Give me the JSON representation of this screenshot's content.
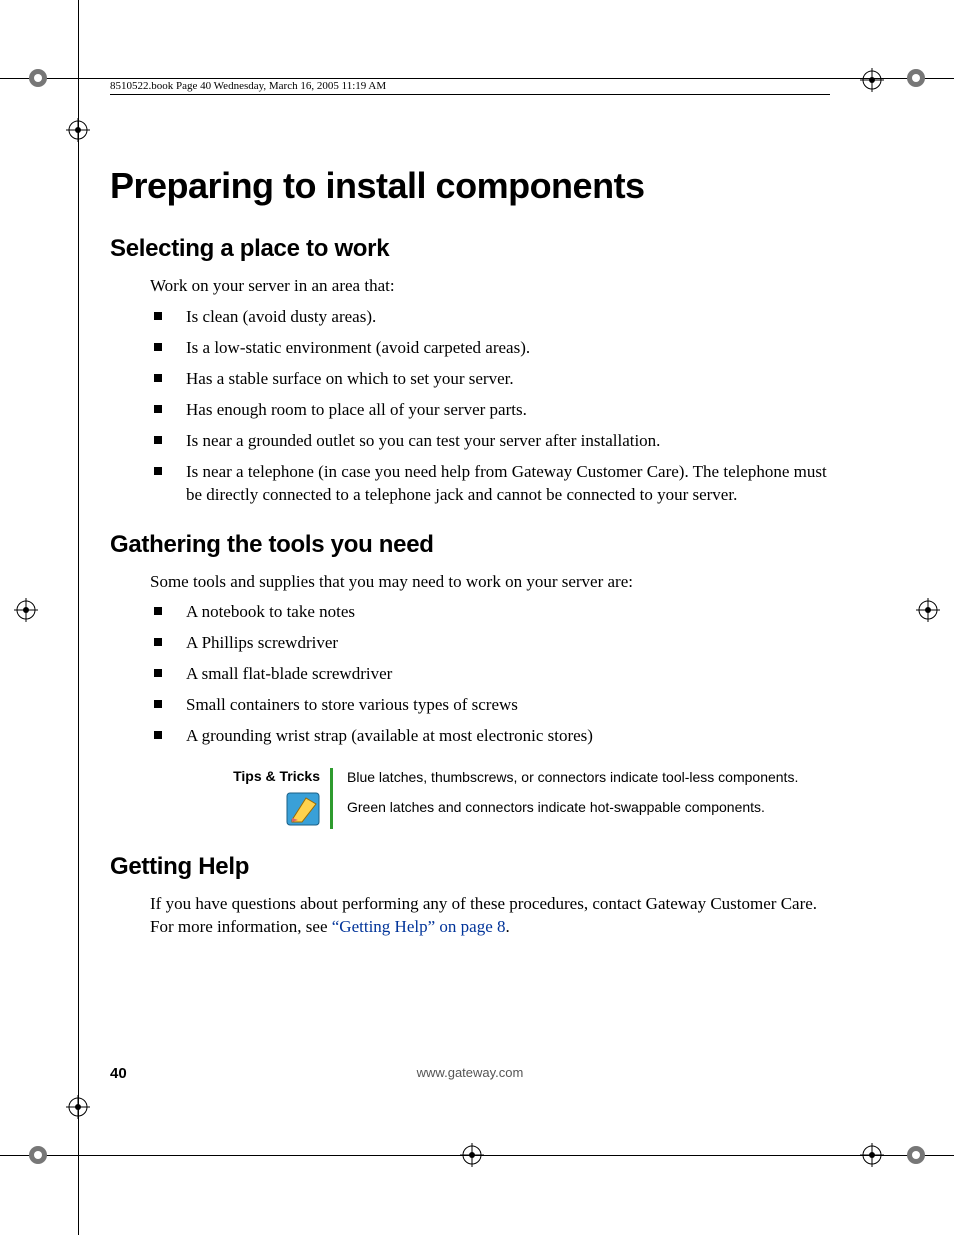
{
  "running_head": "8510522.book  Page 40  Wednesday, March 16, 2005  11:19 AM",
  "title": "Preparing to install components",
  "sections": {
    "selecting": {
      "heading": "Selecting a place to work",
      "intro": "Work on your server in an area that:",
      "bullets": [
        "Is clean (avoid dusty areas).",
        "Is a low-static environment (avoid carpeted areas).",
        "Has a stable surface on which to set your server.",
        "Has enough room to place all of your server parts.",
        "Is near a grounded outlet so you can test your server after installation.",
        "Is near a telephone (in case you need help from Gateway Customer Care). The telephone must be directly connected to a telephone jack and cannot be connected to your server."
      ]
    },
    "tools": {
      "heading": "Gathering the tools you need",
      "intro": "Some tools and supplies that you may need to work on your server are:",
      "bullets": [
        "A notebook to take notes",
        "A Phillips screwdriver",
        "A small flat-blade screwdriver",
        "Small containers to store various types of screws",
        "A grounding wrist strap (available at most electronic stores)"
      ]
    },
    "help": {
      "heading": "Getting Help",
      "text_before_link": "If you have questions about performing any of these procedures, contact Gateway Customer Care. For more information, see ",
      "link_text": "“Getting Help” on page 8",
      "text_after_link": "."
    }
  },
  "tips": {
    "label": "Tips & Tricks",
    "lines": [
      "Blue latches, thumbscrews, or connectors indicate tool-less components.",
      "Green latches and connectors indicate hot-swappable components."
    ]
  },
  "footer": {
    "page_number": "40",
    "url": "www.gateway.com"
  }
}
